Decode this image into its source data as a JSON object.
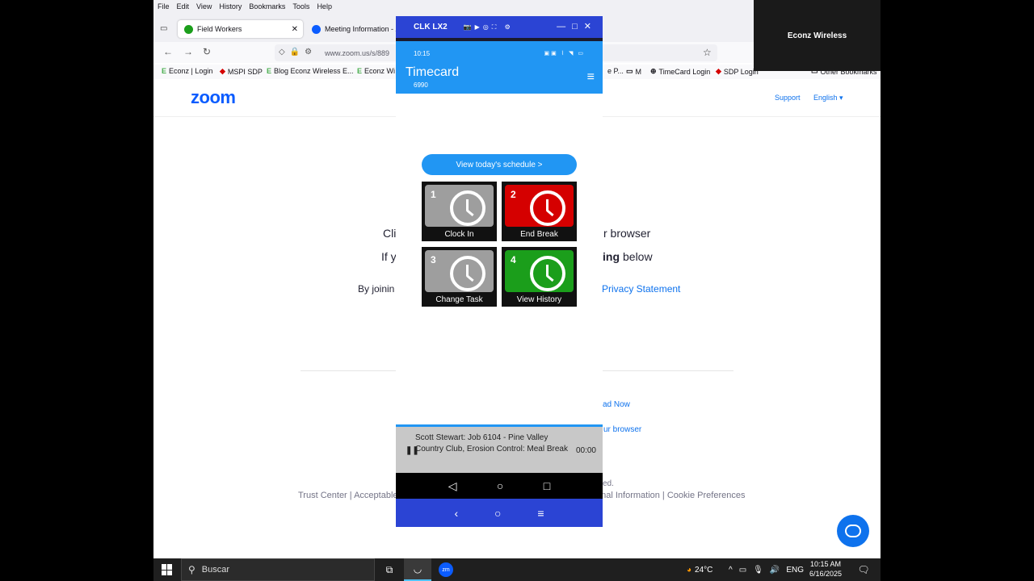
{
  "browser": {
    "menu": [
      "File",
      "Edit",
      "View",
      "History",
      "Bookmarks",
      "Tools",
      "Help"
    ],
    "tabs": [
      {
        "label": "Field Workers",
        "close": "✕"
      },
      {
        "label": "Meeting Information - Z"
      }
    ],
    "url": "www.zoom.us/s/889",
    "bookmarks": [
      {
        "label": "Econz | Login",
        "icon": "E"
      },
      {
        "label": "MSPI SDP",
        "icon": "◆"
      },
      {
        "label": "Blog Econz Wireless E...",
        "icon": "E"
      },
      {
        "label": "Econz Wi",
        "icon": "E"
      },
      {
        "label": "e P...",
        "icon": ""
      },
      {
        "label": "M",
        "icon": "▭"
      },
      {
        "label": "TimeCard Login",
        "icon": "⊕"
      },
      {
        "label": "SDP Login",
        "icon": "◆"
      },
      {
        "label": "Other Bookmarks",
        "icon": "▭"
      }
    ]
  },
  "zoom_page": {
    "logo": "zoom",
    "support": "Support",
    "language": "English ▾",
    "line1_left": "Cli",
    "line1_right": "r browser",
    "line2_left": "If y",
    "line2_bold": "ing",
    "line2_right": "below",
    "line3_left": "By joinin",
    "line3_link": "Privacy Statement",
    "download_link": "ad Now",
    "browser_link": "ur browser",
    "footer_left": "Trust Center | Acceptable U",
    "footer_rights": "ed.",
    "footer_right": "onal Information | Cookie Preferences"
  },
  "participant": {
    "name": "Econz Wireless"
  },
  "phone": {
    "window_title": "CLK LX2",
    "status_time": "10:15",
    "app_title": "Timecard",
    "app_subtitle": "6990",
    "schedule_button": "View today's schedule >",
    "tiles": [
      {
        "num": "1",
        "label": "Clock In",
        "color": "#9e9e9e"
      },
      {
        "num": "2",
        "label": "End Break",
        "color": "#d50000"
      },
      {
        "num": "3",
        "label": "Change Task",
        "color": "#9e9e9e"
      },
      {
        "num": "4",
        "label": "View History",
        "color": "#1b9e1b"
      }
    ],
    "job_text": "Scott Stewart: Job 6104 - Pine Valley Country Club, Erosion Control: Meal Break",
    "job_timer": "00:00"
  },
  "taskbar": {
    "search_placeholder": "Buscar",
    "weather": "24°C",
    "lang": "ENG",
    "time": "10:15 AM",
    "date": "6/16/2025"
  },
  "colors": {
    "zoom_blue": "#0b5cff",
    "timecard_blue": "#2196f3",
    "phone_frame": "#2b44d4"
  }
}
